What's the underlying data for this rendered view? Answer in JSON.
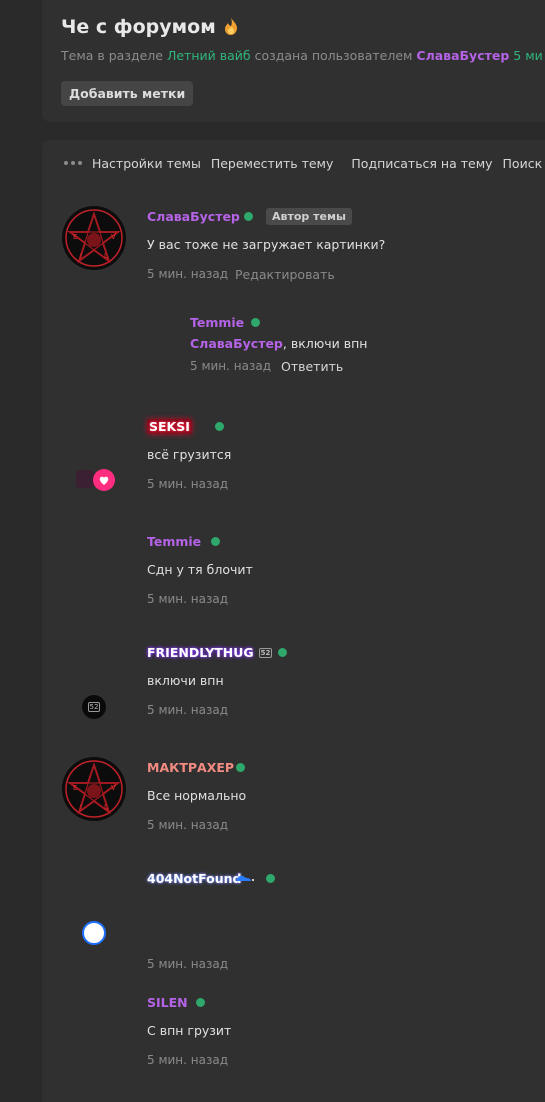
{
  "header": {
    "title": "Че с форумом",
    "meta_prefix": "Тема в разделе",
    "section": "Летний вайб",
    "meta_middle": "создана пользователем",
    "author": "СлаваБустер",
    "age": "5 ми",
    "add_tags": "Добавить метки"
  },
  "toolbar": {
    "settings": "Настройки темы",
    "move": "Переместить тему",
    "subscribe": "Подписаться на тему",
    "search": "Поиск"
  },
  "posts": [
    {
      "author": "СлаваБустер",
      "badge": "Автор темы",
      "text": "У вас тоже не загружает картинки?",
      "time": "5 мин. назад",
      "edit": "Редактировать"
    },
    {
      "author": "SEKSI",
      "text": "всё грузится",
      "time": "5 мин. назад"
    },
    {
      "author": "Temmie",
      "text": "Сдн у тя блочит",
      "time": "5 мин. назад"
    },
    {
      "author": "FRIENDLYTHUG",
      "author_badge": "52",
      "text": "включи впн",
      "time": "5 мин. назад"
    },
    {
      "author": "МАКТРАХЕР",
      "text": "Все нормально",
      "time": "5 мин. назад"
    },
    {
      "author": "404NotFound",
      "time": "5 мин. назад"
    },
    {
      "author": "SILEN",
      "text": "С впн грузит",
      "time": "5 мин. назад"
    }
  ],
  "reply": {
    "author": "Temmie",
    "mention": "СлаваБустер",
    "text": ", включи впн",
    "time": "5 мин. назад",
    "answer": "Ответить"
  },
  "avatar_letters": [
    "E",
    "V",
    "I",
    "L"
  ],
  "avatar_badge": "52",
  "colors": {
    "background": "#2a2a2a",
    "card": "#303030",
    "accent_green": "#2fb67c",
    "username_purple": "#b563e6",
    "online_dot": "#2fa86b"
  }
}
